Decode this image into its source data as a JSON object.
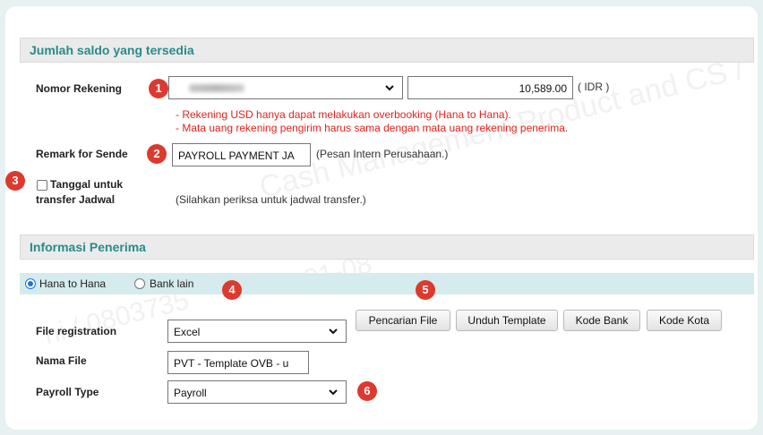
{
  "balance_section": {
    "title": "Jumlah saldo yang tersedia",
    "account_label": "Nomor Rekening",
    "account_value_redacted": true,
    "balance_value": "10,589.00",
    "currency": "( IDR )",
    "warnings": [
      "- Rekening USD hanya dapat melakukan overbooking (Hana to Hana).",
      "- Mata uang rekening pengirim harus sama dengan mata uang rekening penerima."
    ],
    "remark_label": "Remark for Sende",
    "remark_value": "PAYROLL PAYMENT JA",
    "remark_hint": "(Pesan Intern Perusahaan.)",
    "schedule_label_1": "Tanggal untuk",
    "schedule_label_2": "transfer Jadwal",
    "schedule_hint": "(Silahkan periksa untuk jadwal transfer.)"
  },
  "recipient_section": {
    "title": "Informasi Penerima",
    "radio_options": [
      {
        "label": "Hana to Hana",
        "selected": true
      },
      {
        "label": "Bank lain",
        "selected": false
      }
    ],
    "file_reg_label": "File registration",
    "file_reg_value": "Excel",
    "buttons": {
      "search_file": "Pencarian File",
      "download_template": "Unduh Template",
      "bank_code": "Kode Bank",
      "city_code": "Kode Kota"
    },
    "file_name_label": "Nama File",
    "file_name_value": "PVT - Template OVB - u",
    "payroll_type_label": "Payroll Type",
    "payroll_type_value": "Payroll"
  },
  "badges": [
    "1",
    "2",
    "3",
    "4",
    "5",
    "6"
  ],
  "watermark": {
    "line1": "Cash Management Product and CS /",
    "line2": "01-08",
    "line3": "ni / 0803735"
  },
  "colors": {
    "accent_title": "#2a8a8a",
    "badge": "#dc3a2f",
    "warning": "#e0241b",
    "radio_bar": "#d5ebee"
  },
  "icons": {
    "dropdown": "chevron-down-icon"
  }
}
